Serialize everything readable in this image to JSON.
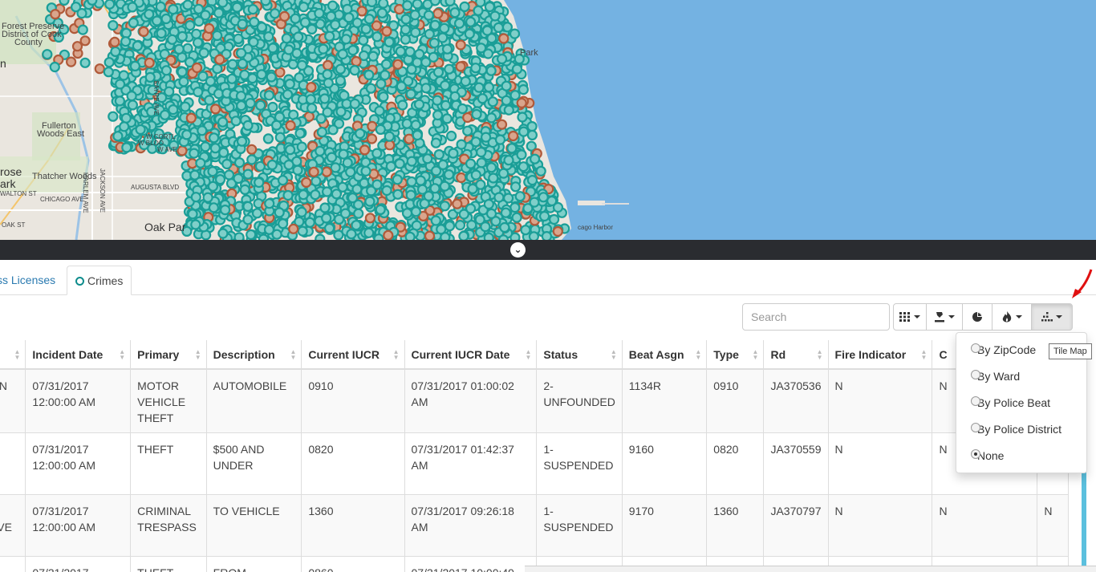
{
  "map": {
    "labels": [
      "Forest Preserve",
      "District of Cook",
      "County",
      "Fullerton",
      "Woods East",
      "rose",
      "ark",
      "Thatcher Woods",
      "WALTON ST",
      "CHICAGO AVE",
      "AUGUSTA BLVD",
      "OAK ST",
      "Oak Par",
      "Park",
      "cago Harbor",
      "n",
      "W CORTL",
      "W BLOO",
      "W AVE",
      "SAYRE AVE",
      "JACKSON AVE",
      "HARLEM AVE"
    ],
    "colors": {
      "water": "#74b2e2",
      "land": "#eae6df",
      "marker": "#1a9e97",
      "marker_alt": "#b05a3a"
    }
  },
  "divider": {
    "toggle_icon": "chevron-down-icon"
  },
  "tabs": [
    {
      "label": "ss Licenses",
      "active": false
    },
    {
      "label": "Crimes",
      "active": true
    }
  ],
  "toolbar": {
    "search_placeholder": "Search",
    "buttons": [
      {
        "icon": "grid-icon",
        "has_caret": true
      },
      {
        "icon": "gavel-icon",
        "has_caret": true
      },
      {
        "icon": "pie-chart-icon",
        "has_caret": false
      },
      {
        "icon": "fire-icon",
        "has_caret": true
      },
      {
        "icon": "tile-map-icon",
        "has_caret": true
      }
    ]
  },
  "table": {
    "columns": [
      "s",
      "Incident Date",
      "Primary",
      "Description",
      "Current IUCR",
      "Current IUCR Date",
      "Status",
      "Beat Asgn",
      "Type",
      "Rd",
      "Fire Indicator",
      "C",
      ""
    ],
    "rows": [
      [
        "ON",
        "07/31/2017 12:00:00 AM",
        "MOTOR VEHICLE THEFT",
        "AUTOMOBILE",
        "0910",
        "07/31/2017 01:00:02 AM",
        "2-UNFOUNDED",
        "1134R",
        "0910",
        "JA370536",
        "N",
        "N",
        ""
      ],
      [
        "N",
        "07/31/2017 12:00:00 AM",
        "THEFT",
        "$500 AND UNDER",
        "0820",
        "07/31/2017 01:42:37 AM",
        "1-SUSPENDED",
        "9160",
        "0820",
        "JA370559",
        "N",
        "N",
        ""
      ],
      [
        "E AVE",
        "07/31/2017 12:00:00 AM",
        "CRIMINAL TRESPASS",
        "TO VEHICLE",
        "1360",
        "07/31/2017 09:26:18 AM",
        "1-SUSPENDED",
        "9170",
        "1360",
        "JA370797",
        "N",
        "N",
        "N"
      ],
      [
        "",
        "07/31/2017",
        "THEFT",
        "FROM",
        "0860",
        "07/31/2017 10:00:49",
        "3-OPEN",
        "9150",
        "0860",
        "JA370882",
        "N",
        "",
        ""
      ]
    ]
  },
  "dropdown": {
    "options": [
      {
        "label": "By ZipCode",
        "checked": false
      },
      {
        "label": "By Ward",
        "checked": false
      },
      {
        "label": "By Police Beat",
        "checked": false
      },
      {
        "label": "By Police District",
        "checked": false
      },
      {
        "label": "None",
        "checked": true
      }
    ]
  },
  "tooltip": "Tile Map"
}
